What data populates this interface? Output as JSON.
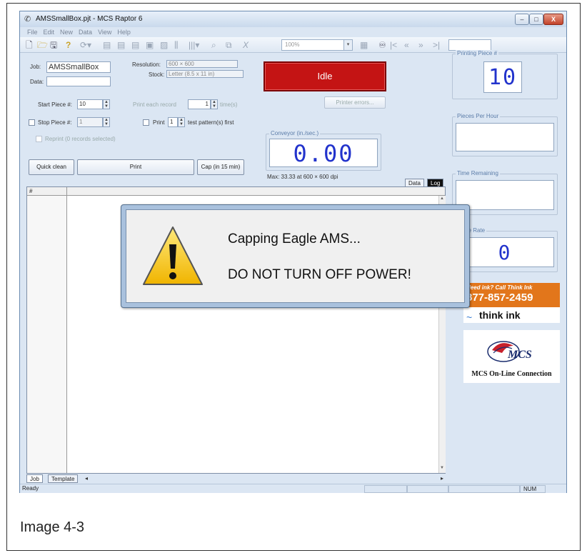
{
  "window": {
    "title": "AMSSmallBox.pjt - MCS Raptor 6",
    "minimize": "–",
    "maximize": "□",
    "close": "X"
  },
  "menu": [
    "File",
    "Edit",
    "New",
    "Data",
    "View",
    "Help"
  ],
  "toolbar": {
    "zoom": "100%"
  },
  "job": {
    "job_label": "Job:",
    "job_value": "AMSSmallBox",
    "data_label": "Data:",
    "data_value": "",
    "resolution_label": "Resolution:",
    "resolution_value": "600 × 600",
    "stock_label": "Stock:",
    "stock_value": "Letter (8.5 x 11 in)"
  },
  "pieces": {
    "start_label": "Start Piece #:",
    "start_value": "10",
    "stop_label": "Stop Piece #:",
    "stop_value": "1",
    "print_each_label": "Print each record",
    "print_each_value": "1",
    "print_each_unit": "time(s)",
    "print_label": "Print",
    "print_value": "1",
    "test_pattern_label": "test pattern(s) first",
    "reprint_label": "Reprint (0 records selected)"
  },
  "buttons": {
    "quick_clean": "Quick clean",
    "print": "Print",
    "cap": "Cap (in 15 min)",
    "printer_errors": "Printer errors..."
  },
  "status": {
    "state": "Idle",
    "status_color": "#c41414"
  },
  "conveyor": {
    "title": "Conveyor (in./sec.)",
    "value": "0.00",
    "max_text": "Max: 33.33 at 600 × 600 dpi"
  },
  "tabs": {
    "data": "Data",
    "log": "Log",
    "job": "Job",
    "template": "Template"
  },
  "grid": {
    "column_header": "#"
  },
  "right_panel": {
    "printing_piece_title": "Printing Piece #",
    "printing_piece_value": "10",
    "pieces_per_hour_title": "Pieces Per Hour",
    "pieces_per_hour_value": "",
    "time_remaining_title": "Time Remaining",
    "time_remaining_value": "",
    "piece_rate_title": "Piece Rate",
    "piece_rate_value": "0"
  },
  "ads": {
    "thinkink_line1": "Need ink? Call Think Ink",
    "thinkink_phone": "877-857-2459",
    "thinkink_brand": "think ink",
    "mcs_brand": "MCS",
    "mcs_caption": "MCS On-Line Connection"
  },
  "statusbar": {
    "text": "Ready",
    "num": "NUM"
  },
  "dialog": {
    "line1": "Capping Eagle AMS...",
    "line2": "DO NOT TURN OFF POWER!"
  },
  "caption": "Image 4-3"
}
